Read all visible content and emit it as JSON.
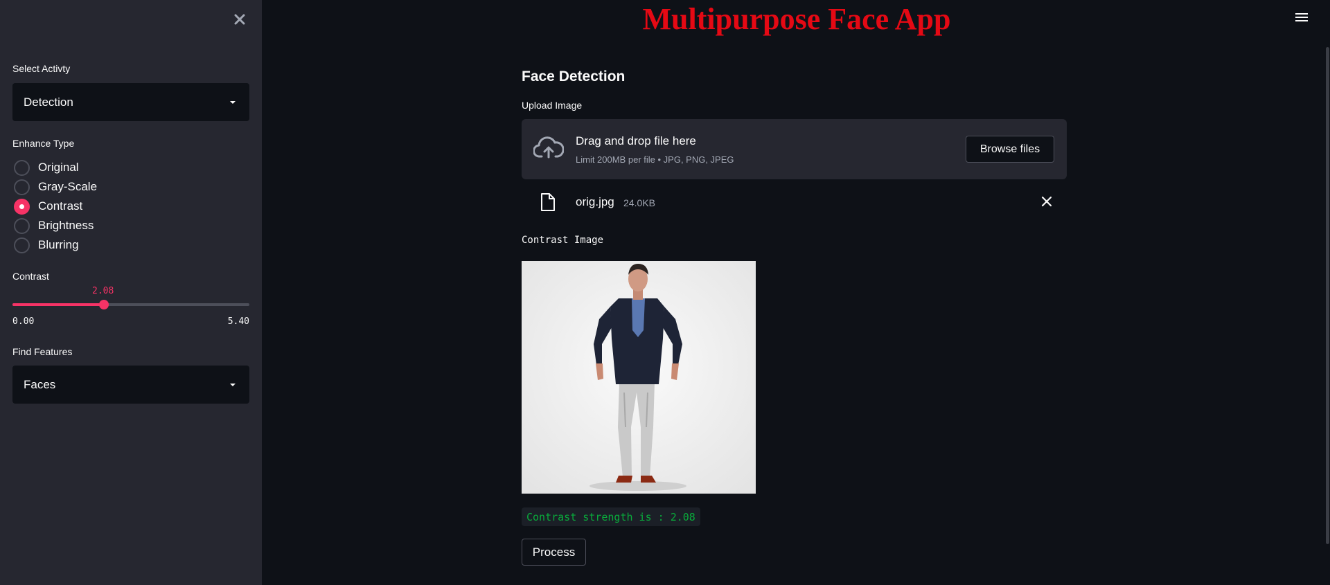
{
  "app": {
    "title": "Multipurpose Face App",
    "menu_icon": "hamburger-menu-icon"
  },
  "sidebar": {
    "close_icon": "close-icon",
    "activity_label": "Select Activty",
    "activity_value": "Detection",
    "enhance_label": "Enhance Type",
    "enhance_options": [
      {
        "label": "Original",
        "checked": false
      },
      {
        "label": "Gray-Scale",
        "checked": false
      },
      {
        "label": "Contrast",
        "checked": true
      },
      {
        "label": "Brightness",
        "checked": false
      },
      {
        "label": "Blurring",
        "checked": false
      }
    ],
    "contrast_label": "Contrast",
    "contrast": {
      "value": "2.08",
      "min": "0.00",
      "max": "5.40",
      "fraction": 0.385
    },
    "features_label": "Find Features",
    "features_value": "Faces"
  },
  "main": {
    "section_title": "Face Detection",
    "upload_label": "Upload Image",
    "dropzone": {
      "title": "Drag and drop file here",
      "subtitle": "Limit 200MB per file • JPG, PNG, JPEG",
      "browse_label": "Browse files"
    },
    "file": {
      "name": "orig.jpg",
      "size": "24.0KB"
    },
    "image_caption": "Contrast Image",
    "strength_text": "Contrast strength is : 2.08",
    "process_label": "Process"
  },
  "colors": {
    "accent": "#f63366",
    "title_red": "#e50914",
    "success_green": "#09ab3b",
    "sidebar_bg": "#262730",
    "main_bg": "#0e1117"
  }
}
